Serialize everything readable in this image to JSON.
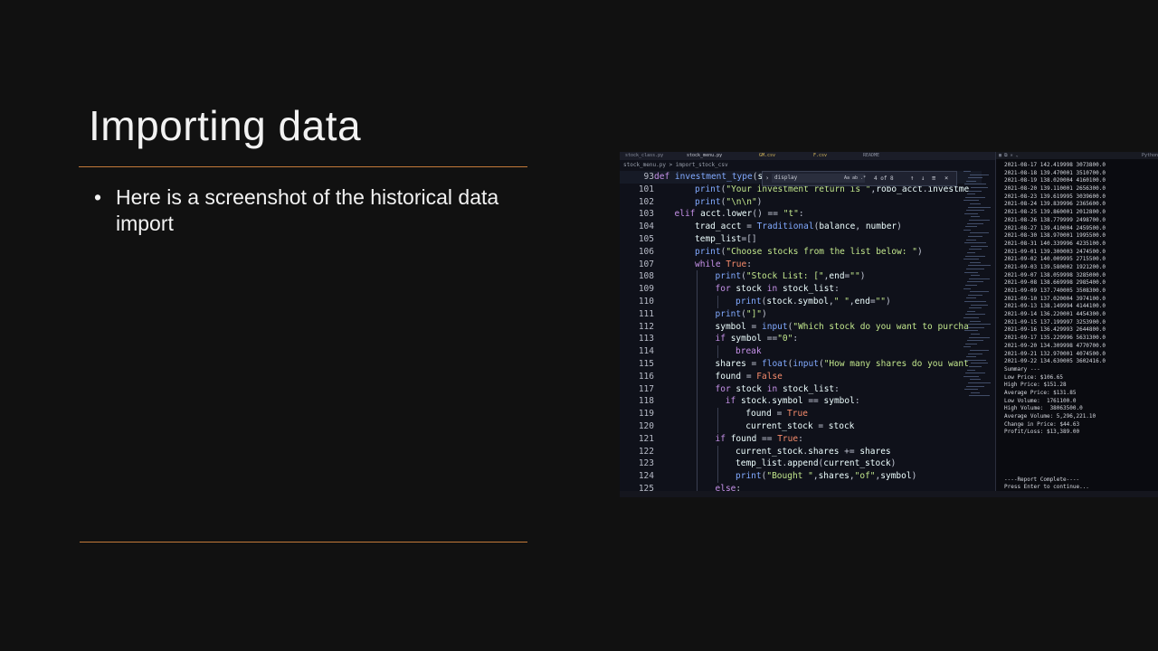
{
  "slide": {
    "title": "Importing data",
    "bullets": [
      "Here is a screenshot of the historical data import"
    ]
  },
  "editor": {
    "tabs": [
      "stock_class.py",
      "stock_menu.py",
      "GM.csv",
      "F.csv",
      "README"
    ],
    "breadcrumb": "stock_menu.py > import_stock_csv",
    "find": {
      "query": "display",
      "count": "4 of 8",
      "options": "Aa ab .*"
    },
    "lines": [
      {
        "n": "93",
        "indent": 0,
        "text": "def investment_type(s"
      },
      {
        "n": "101",
        "indent": 2,
        "text": "print(\"Your investment return is \",robo_acct.investme"
      },
      {
        "n": "102",
        "indent": 2,
        "text": "print(\"\\n\\n\")"
      },
      {
        "n": "103",
        "indent": 1,
        "text": "elif acct.lower() == \"t\":"
      },
      {
        "n": "104",
        "indent": 2,
        "text": "trad_acct = Traditional(balance, number)"
      },
      {
        "n": "105",
        "indent": 2,
        "text": "temp_list=[]"
      },
      {
        "n": "106",
        "indent": 2,
        "text": "print(\"Choose stocks from the list below: \")"
      },
      {
        "n": "107",
        "indent": 2,
        "text": "while True:"
      },
      {
        "n": "108",
        "indent": 3,
        "text": "print(\"Stock List: [\",end=\"\")"
      },
      {
        "n": "109",
        "indent": 3,
        "text": "for stock in stock_list:"
      },
      {
        "n": "110",
        "indent": 4,
        "text": "print(stock.symbol,\" \",end=\"\")"
      },
      {
        "n": "111",
        "indent": 3,
        "text": "print(\"]\")"
      },
      {
        "n": "112",
        "indent": 3,
        "text": "symbol = input(\"Which stock do you want to purcha"
      },
      {
        "n": "113",
        "indent": 3,
        "text": "if symbol ==\"0\":"
      },
      {
        "n": "114",
        "indent": 4,
        "text": "break"
      },
      {
        "n": "115",
        "indent": 3,
        "text": "shares = float(input(\"How many shares do you want"
      },
      {
        "n": "116",
        "indent": 3,
        "text": "found = False"
      },
      {
        "n": "117",
        "indent": 3,
        "text": "for stock in stock_list:"
      },
      {
        "n": "118",
        "indent": 3.5,
        "text": "if stock.symbol == symbol:"
      },
      {
        "n": "119",
        "indent": 4.5,
        "text": "found = True"
      },
      {
        "n": "120",
        "indent": 4.5,
        "text": "current_stock = stock"
      },
      {
        "n": "121",
        "indent": 3,
        "text": "if found == True:"
      },
      {
        "n": "122",
        "indent": 4,
        "text": "current_stock.shares += shares"
      },
      {
        "n": "123",
        "indent": 4,
        "text": "temp_list.append(current_stock)"
      },
      {
        "n": "124",
        "indent": 4,
        "text": "print(\"Bought \",shares,\"of\",symbol)"
      },
      {
        "n": "125",
        "indent": 3,
        "text": "else:"
      }
    ]
  },
  "terminal": {
    "title": "Python",
    "lines": [
      "2021-08-17 142.419998 3073800.0",
      "2021-08-18 139.470001 3510700.0",
      "2021-08-19 138.020004 4160100.0",
      "2021-08-20 139.110001 2656300.0",
      "2021-08-23 139.619995 3039600.0",
      "2021-08-24 139.839996 2365600.0",
      "2021-08-25 139.860001 2012800.0",
      "2021-08-26 138.779999 2498700.0",
      "2021-08-27 139.410004 2459500.0",
      "2021-08-30 138.970001 1995500.0",
      "2021-08-31 140.339996 4235100.0",
      "2021-09-01 139.300003 2474500.0",
      "2021-09-02 140.009995 2715500.0",
      "2021-09-03 139.580002 1921200.0",
      "2021-09-07 138.059998 3285000.0",
      "2021-09-08 138.669998 2985400.0",
      "2021-09-09 137.740005 3508300.0",
      "2021-09-10 137.020004 3974100.0",
      "2021-09-13 138.149994 4144100.0",
      "2021-09-14 136.220001 4454300.0",
      "2021-09-15 137.199997 3253900.0",
      "2021-09-16 136.429993 2644800.0",
      "2021-09-17 135.229996 5631300.0",
      "2021-09-20 134.309998 4770700.0",
      "2021-09-21 132.970001 4074500.0",
      "2021-09-22 134.630005 3602416.0",
      "Summary ---",
      "Low Price: $106.65",
      "High Price: $151.28",
      "Average Price: $131.85",
      "Low Volume:  1761100.0",
      "High Volume:  38063500.0",
      "Average Volume: 5,296,221.10",
      "Change in Price: $44.63",
      "Profit/Loss: $13,389.00",
      "",
      "",
      "",
      "",
      "",
      "----Report Complete----",
      "Press Enter to continue..."
    ]
  },
  "colors": {
    "background": "#111111",
    "accent_rule": "#c47a3a",
    "keyword": "#c792ea",
    "string": "#c3e88d",
    "function": "#82aaff",
    "identifier": "#eeffff",
    "number": "#f78c6c"
  }
}
